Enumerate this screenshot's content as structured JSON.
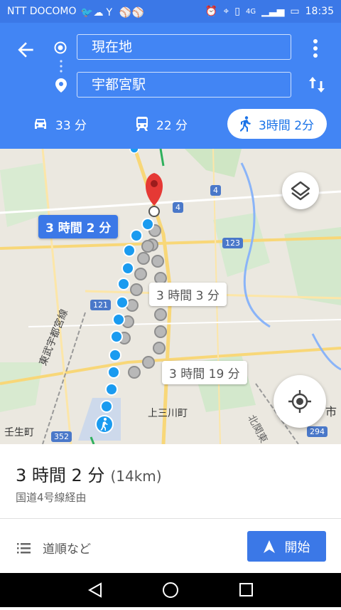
{
  "status_bar": {
    "carrier": "NTT DOCOMO",
    "network": "4G",
    "time": "18:35"
  },
  "header": {
    "origin": "現在地",
    "destination": "宇都宮駅",
    "modes": [
      {
        "id": "car",
        "time": "33 分"
      },
      {
        "id": "transit",
        "time": "22 分"
      },
      {
        "id": "walk",
        "time": "3時間 2分"
      }
    ]
  },
  "map": {
    "route_labels": [
      "3 時間 2 分",
      "3 時間 3 分",
      "3 時間 19 分"
    ],
    "place_labels": {
      "kamimikawa": "上三川町",
      "mibu": "壬生町",
      "ichi": "市"
    },
    "rail_labels": {
      "tobu": "東武宇都宮線",
      "kitakanto": "北関東"
    },
    "road_shields": [
      "4",
      "4",
      "123",
      "121",
      "352",
      "294"
    ]
  },
  "summary": {
    "duration": "3 時間 2 分",
    "distance": "(14km)",
    "via": "国道4号線経由"
  },
  "actions": {
    "steps_label": "道順など",
    "start_label": "開始"
  },
  "colors": {
    "header_blue": "#4285f4",
    "status_blue": "#3b78e7",
    "route_blue": "#1a9bf0",
    "alt_route_gray": "#bdbdbd"
  }
}
